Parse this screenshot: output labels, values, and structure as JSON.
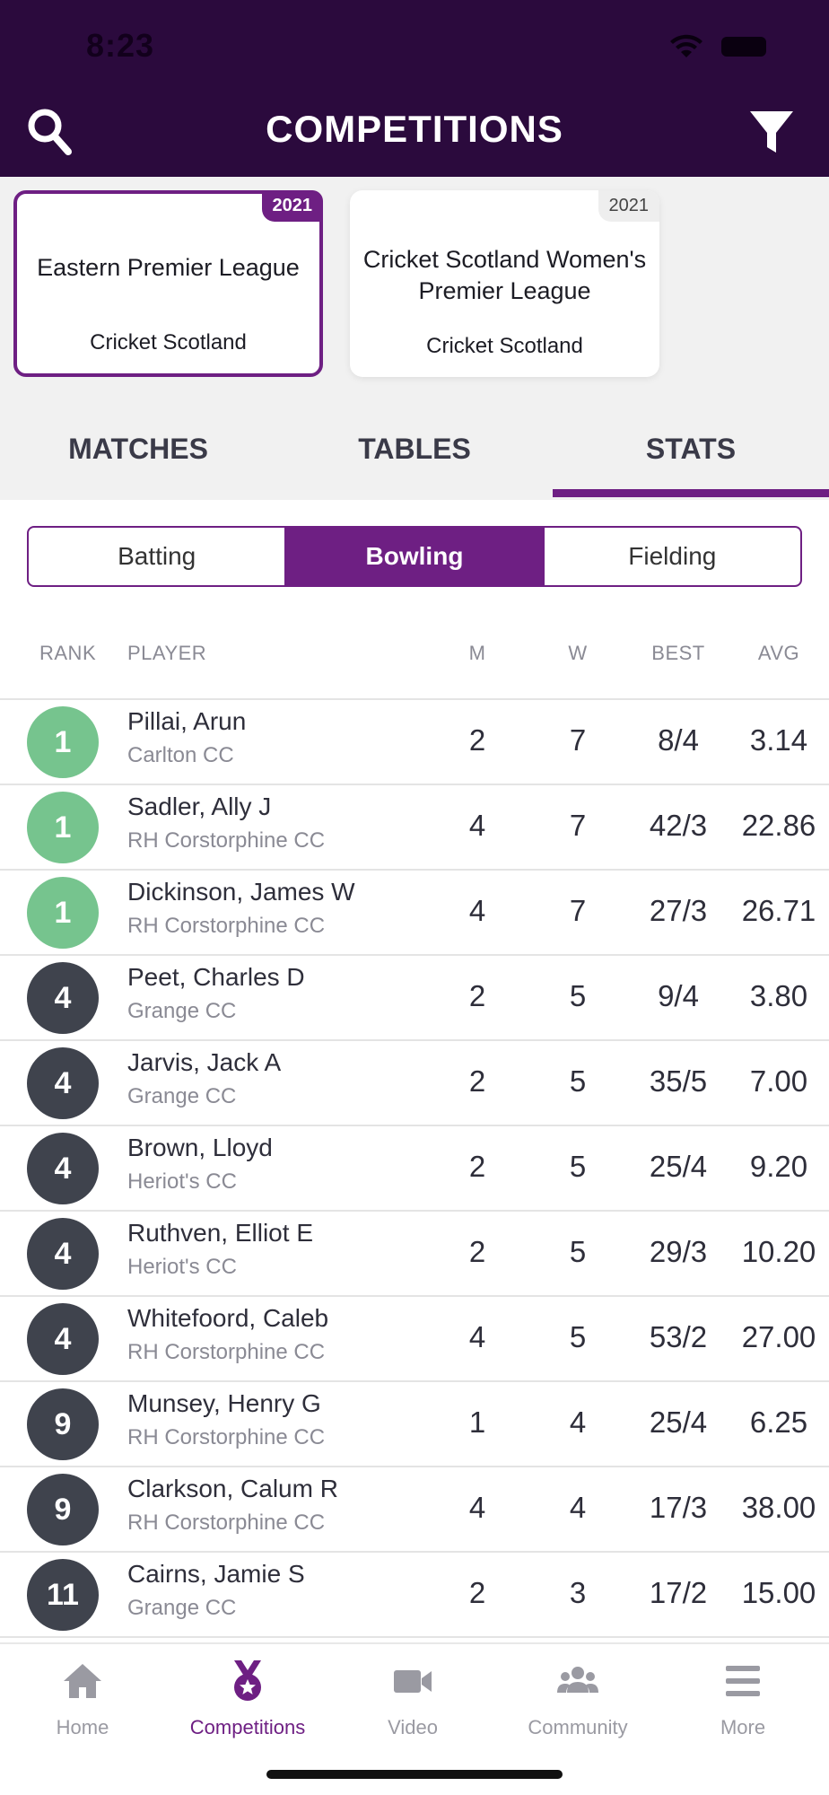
{
  "status": {
    "time": "8:23"
  },
  "header": {
    "title": "COMPETITIONS"
  },
  "competitions": [
    {
      "year": "2021",
      "name": "Eastern Premier League",
      "org": "Cricket Scotland"
    },
    {
      "year": "2021",
      "name": "Cricket Scotland Women's Premier League",
      "org": "Cricket Scotland"
    }
  ],
  "tabs": [
    {
      "label": "MATCHES"
    },
    {
      "label": "TABLES"
    },
    {
      "label": "STATS"
    }
  ],
  "segments": [
    {
      "label": "Batting"
    },
    {
      "label": "Bowling"
    },
    {
      "label": "Fielding"
    }
  ],
  "columns": {
    "rank": "RANK",
    "player": "PLAYER",
    "m": "M",
    "w": "W",
    "best": "BEST",
    "avg": "AVG"
  },
  "rows": [
    {
      "rank": "1",
      "name": "Pillai, Arun",
      "club": "Carlton CC",
      "m": "2",
      "w": "7",
      "best": "8/4",
      "avg": "3.14"
    },
    {
      "rank": "1",
      "name": "Sadler, Ally J",
      "club": "RH Corstorphine CC",
      "m": "4",
      "w": "7",
      "best": "42/3",
      "avg": "22.86"
    },
    {
      "rank": "1",
      "name": "Dickinson, James W",
      "club": "RH Corstorphine CC",
      "m": "4",
      "w": "7",
      "best": "27/3",
      "avg": "26.71"
    },
    {
      "rank": "4",
      "name": "Peet, Charles D",
      "club": "Grange CC",
      "m": "2",
      "w": "5",
      "best": "9/4",
      "avg": "3.80"
    },
    {
      "rank": "4",
      "name": "Jarvis, Jack A",
      "club": "Grange CC",
      "m": "2",
      "w": "5",
      "best": "35/5",
      "avg": "7.00"
    },
    {
      "rank": "4",
      "name": "Brown, Lloyd",
      "club": "Heriot's CC",
      "m": "2",
      "w": "5",
      "best": "25/4",
      "avg": "9.20"
    },
    {
      "rank": "4",
      "name": "Ruthven, Elliot E",
      "club": "Heriot's CC",
      "m": "2",
      "w": "5",
      "best": "29/3",
      "avg": "10.20"
    },
    {
      "rank": "4",
      "name": "Whitefoord, Caleb",
      "club": "RH Corstorphine CC",
      "m": "4",
      "w": "5",
      "best": "53/2",
      "avg": "27.00"
    },
    {
      "rank": "9",
      "name": "Munsey, Henry G",
      "club": "RH Corstorphine CC",
      "m": "1",
      "w": "4",
      "best": "25/4",
      "avg": "6.25"
    },
    {
      "rank": "9",
      "name": "Clarkson, Calum R",
      "club": "RH Corstorphine CC",
      "m": "4",
      "w": "4",
      "best": "17/3",
      "avg": "38.00"
    },
    {
      "rank": "11",
      "name": "Cairns, Jamie S",
      "club": "Grange CC",
      "m": "2",
      "w": "3",
      "best": "17/2",
      "avg": "15.00"
    }
  ],
  "nav": [
    {
      "label": "Home",
      "icon": "home-icon"
    },
    {
      "label": "Competitions",
      "icon": "medal-icon"
    },
    {
      "label": "Video",
      "icon": "video-camera-icon"
    },
    {
      "label": "Community",
      "icon": "people-icon"
    },
    {
      "label": "More",
      "icon": "menu-icon"
    }
  ],
  "colors": {
    "header_bg": "#2b0a3d",
    "accent": "#6e1f83",
    "rank_top": "#76c48e",
    "rank_other": "#3f434d"
  }
}
